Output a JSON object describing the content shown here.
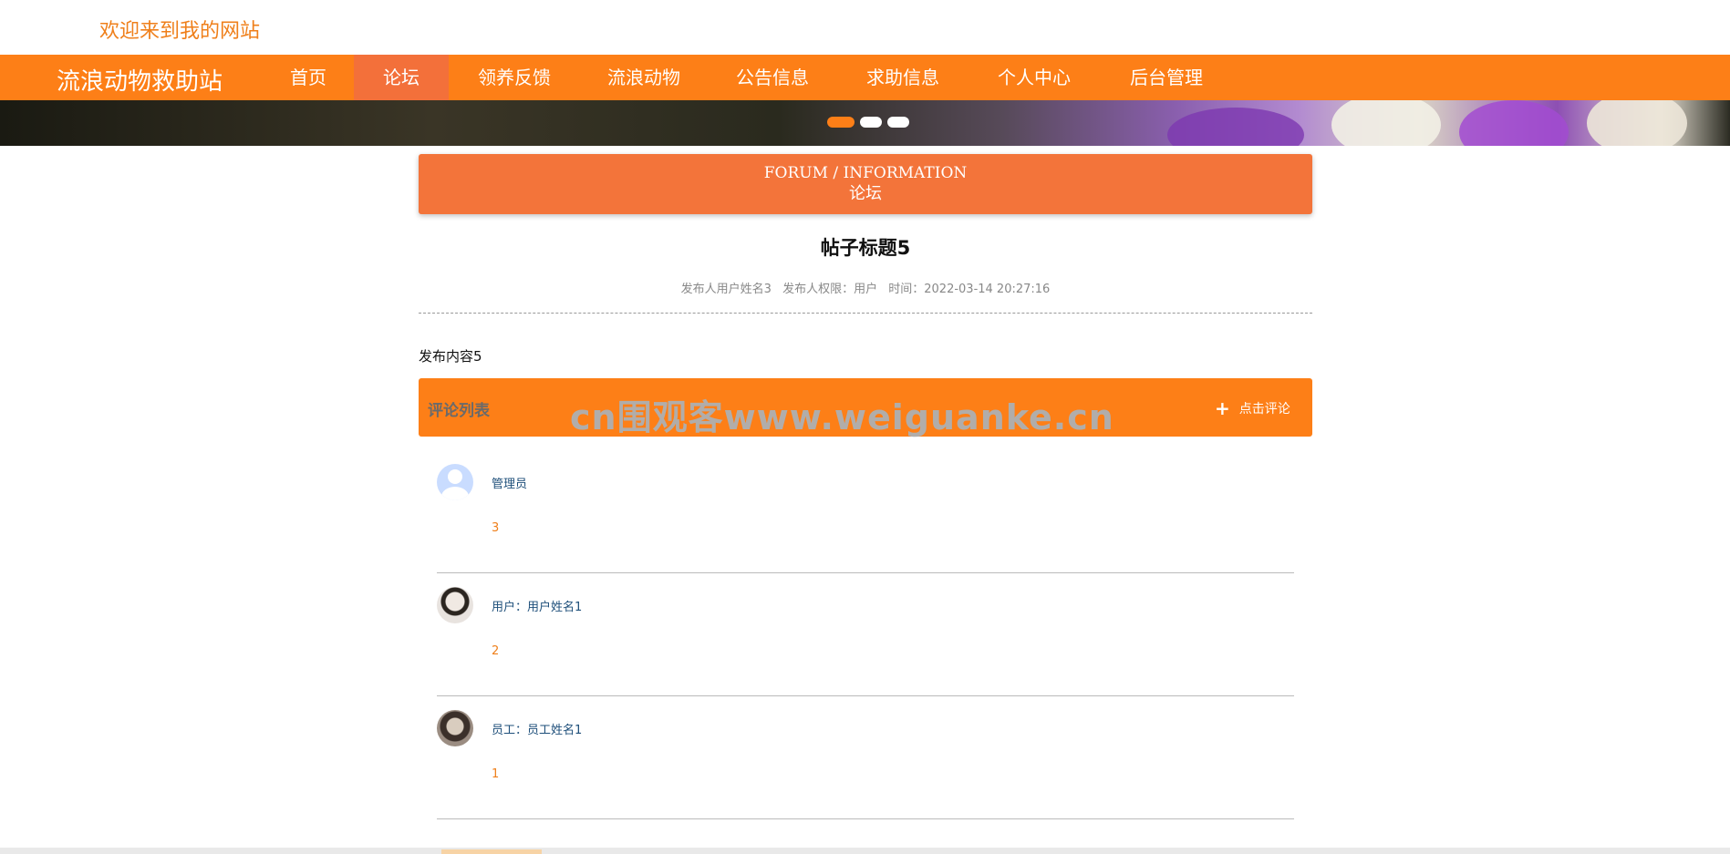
{
  "header": {
    "welcome": "欢迎来到我的网站"
  },
  "navbar": {
    "brand": "流浪动物救助站",
    "items": [
      {
        "label": "首页",
        "active": false
      },
      {
        "label": "论坛",
        "active": true
      },
      {
        "label": "领养反馈",
        "active": false
      },
      {
        "label": "流浪动物",
        "active": false
      },
      {
        "label": "公告信息",
        "active": false
      },
      {
        "label": "求助信息",
        "active": false
      },
      {
        "label": "个人中心",
        "active": false
      },
      {
        "label": "后台管理",
        "active": false
      }
    ]
  },
  "section": {
    "en": "FORUM / INFORMATION",
    "cn": "论坛"
  },
  "post": {
    "title": "帖子标题5",
    "author": "发布人用户姓名3",
    "role": "发布人权限：用户",
    "time": "时间：2022-03-14 20:27:16",
    "content": "发布内容5"
  },
  "comments_bar": {
    "label": "评论列表",
    "watermark": "cn围观客www.weiguanke.cn",
    "add_label": "点击评论"
  },
  "comments": [
    {
      "name": "管理员",
      "text": "3",
      "avatar": "default-avatar-icon"
    },
    {
      "name": "用户：用户姓名1",
      "text": "2",
      "avatar": "user-photo"
    },
    {
      "name": "员工：员工姓名1",
      "text": "1",
      "avatar": "staff-photo"
    }
  ],
  "colors": {
    "primary": "#fd7f17",
    "active_nav": "#f3703a",
    "section_header": "#f3743a",
    "link": "#1e4f7a"
  }
}
